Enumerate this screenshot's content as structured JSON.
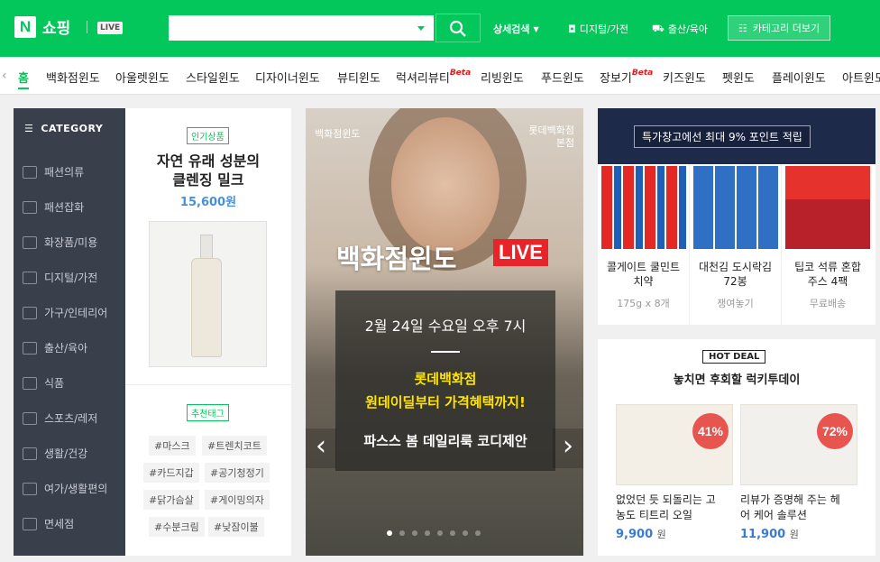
{
  "header": {
    "logo_letter": "N",
    "logo_text": "쇼핑",
    "live_brand": "쇼핑",
    "live_tag": "LIVE",
    "search": {
      "placeholder": ""
    },
    "links": [
      "상세검색",
      "디지털/가전",
      "출산/육아"
    ],
    "category_more": "카테고리 더보기",
    "accent": "#03c75a"
  },
  "nav": {
    "items": [
      "홈",
      "백화점윈도",
      "아울렛윈도",
      "스타일윈도",
      "디자이너윈도",
      "뷰티윈도",
      "럭셔리뷰티",
      "리빙윈도",
      "푸드윈도",
      "장보기",
      "키즈윈도",
      "펫윈도",
      "플레이윈도",
      "아트윈도"
    ],
    "beta": "Beta"
  },
  "category": {
    "title": "CATEGORY",
    "items": [
      "패션의류",
      "패션잡화",
      "화장품/미용",
      "디지털/가전",
      "가구/인테리어",
      "출산/육아",
      "식품",
      "스포츠/레저",
      "생활/건강",
      "여가/생활편의",
      "면세점"
    ]
  },
  "popular": {
    "badge": "인기상품",
    "title_line1": "자연 유래 성분의",
    "title_line2": "클렌징 밀크",
    "price": "15,600원",
    "tag_badge": "추천태그",
    "tags": [
      "#마스크",
      "#트렌치코트",
      "#카드지갑",
      "#공기청정기",
      "#닭가슴살",
      "#게이밍의자",
      "#수분크림",
      "#낮잠이불"
    ]
  },
  "banner": {
    "top_left": "백화점윈도",
    "top_right_1": "롯데백화점",
    "top_right_2": "본점",
    "title": "백화점윈도",
    "live": "LIVE",
    "date": "2월 24일 수요일 오후 7시",
    "yellow_1": "롯데백화점",
    "yellow_2": "원데이딜부터 가격혜택까지!",
    "subtitle": "파스스 봄 데일리룩 코디제안",
    "slide_count": 8,
    "active_slide": 1
  },
  "promo": {
    "caption": "특가창고에선 최대 9% 포인트 적립",
    "products": [
      {
        "name_1": "콜게이트 쿨민트",
        "name_2": "치약",
        "meta": "175g x 8개"
      },
      {
        "name_1": "대천김 도시락김",
        "name_2": "72봉",
        "meta": "쟁여놓기"
      },
      {
        "name_1": "팁코 석류 혼합",
        "name_2": "주스 4팩",
        "meta": "무료배송"
      }
    ]
  },
  "hotdeal": {
    "badge": "HOT DEAL",
    "title": "놓치면 후회할 럭키투데이",
    "items": [
      {
        "discount": "41%",
        "name_1": "없었던 듯 되돌리는 고",
        "name_2": "농도 티트리 오일",
        "price": "9,900",
        "unit": "원"
      },
      {
        "discount": "72%",
        "name_1": "리뷰가 증명해 주는 헤",
        "name_2": "어 케어 솔루션",
        "price": "11,900",
        "unit": "원"
      }
    ]
  }
}
